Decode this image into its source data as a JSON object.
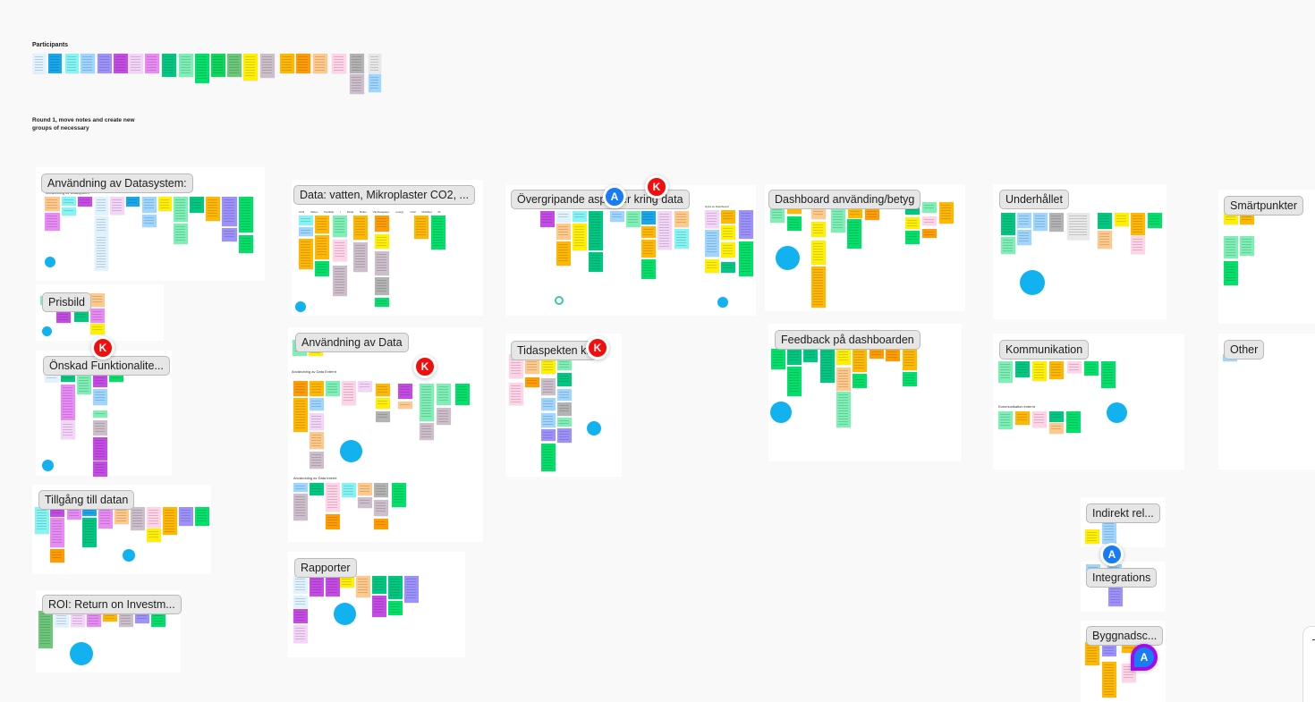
{
  "board": {
    "participants_title": "Participants",
    "instructions": "Round 1, move notes and create new groups of necessary",
    "colors": {
      "vote_dot": "#12b1ef",
      "cursor_a": "#1a7cf5",
      "cursor_k": "#f30e0e",
      "cursor_a_highlight": "#a20be8"
    }
  },
  "frames": [
    {
      "id": "anvandning-datasystem",
      "label": "Användning av Datasystem:",
      "sublabel": "Användning av Datasystem"
    },
    {
      "id": "data-vatten",
      "label": "Data: vatten, Mikroplaster CO2, ...",
      "sublabel": "CO2   Vatten   Partiklar / Flöde   Buller   Växthusgaser, energi, CO2   Mobilitet   IR"
    },
    {
      "id": "overgripande",
      "label": "Övergripande aspekter kring data",
      "sublabel": "Nytta av Dashboard"
    },
    {
      "id": "dashboard",
      "label": "Dashboard använding/betyg"
    },
    {
      "id": "underhallet",
      "label": "Underhållet"
    },
    {
      "id": "smartpunkter",
      "label": "Smärtpunkter"
    },
    {
      "id": "prisbild",
      "label": "Prisbild"
    },
    {
      "id": "onskad",
      "label": "Önskad Funktionalite..."
    },
    {
      "id": "anvandning-data",
      "label": "Användning av Data",
      "sublabel": "Användning av Data Externt",
      "sublabel2": "Användning av Data Internt"
    },
    {
      "id": "tidaspekten",
      "label": "Tidaspekten kring data"
    },
    {
      "id": "feedback",
      "label": "Feedback på dashboarden"
    },
    {
      "id": "kommunikation",
      "label": "Kommunikation",
      "sublabel": "Kommunikation externt"
    },
    {
      "id": "other",
      "label": "Other"
    },
    {
      "id": "tillgang",
      "label": "Tillgång till datan"
    },
    {
      "id": "roi",
      "label": "ROI: Return on Investm..."
    },
    {
      "id": "rapporter",
      "label": "Rapporter"
    },
    {
      "id": "indirekt",
      "label": "Indirekt rel..."
    },
    {
      "id": "integrations",
      "label": "Integrations"
    },
    {
      "id": "byggnadsc",
      "label": "Byggnadsc..."
    }
  ],
  "cursors": [
    {
      "id": "a1",
      "initial": "A"
    },
    {
      "id": "k1",
      "initial": "K"
    },
    {
      "id": "k2",
      "initial": "K"
    },
    {
      "id": "k3",
      "initial": "K"
    },
    {
      "id": "k4",
      "initial": "K"
    },
    {
      "id": "a2",
      "initial": "A"
    },
    {
      "id": "a3",
      "initial": "A"
    }
  ]
}
